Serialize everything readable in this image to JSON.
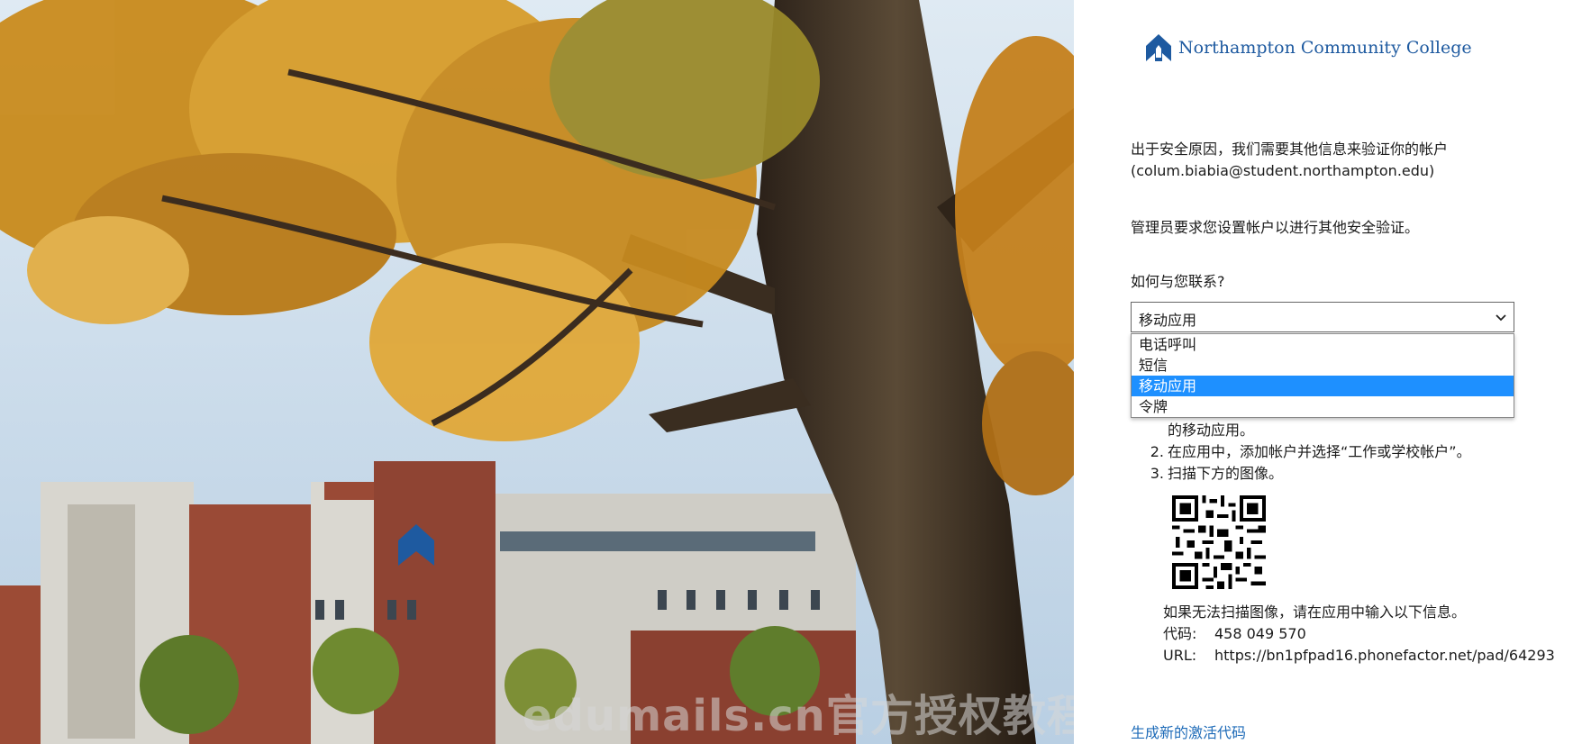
{
  "org": {
    "name": "Northampton Community College"
  },
  "prompt": {
    "security_line": "出于安全原因，我们需要其他信息来验证你的帐户",
    "account": "(colum.biabia@student.northampton.edu)",
    "admin_line": "管理员要求您设置帐户以进行其他安全验证。",
    "contact_question": "如何与您联系?"
  },
  "contact_method": {
    "selected": "移动应用",
    "options": [
      "电话呼叫",
      "短信",
      "移动应用",
      "令牌"
    ]
  },
  "steps": {
    "item1_tail": "的移动应用。",
    "item2_num": "2.",
    "item2": "在应用中，添加帐户并选择“工作或学校帐户”。",
    "item3_num": "3.",
    "item3": "扫描下方的图像。"
  },
  "fallback": {
    "intro": "如果无法扫描图像，请在应用中输入以下信息。",
    "code_label": "代码:",
    "code_value": "458 049 570",
    "url_label": "URL:",
    "url_value": "https://bn1pfpad16.phonefactor.net/pad/64293"
  },
  "links": {
    "regenerate": "生成新的激活代码"
  },
  "watermark": "edumails.cn官方授权教程",
  "colors": {
    "accent": "#1e90ff",
    "brand": "#1e5aa0",
    "link": "#1e6bb8"
  },
  "icons": {
    "dropdown": "chevron-down-icon",
    "logo": "ncc-logo-mark"
  }
}
